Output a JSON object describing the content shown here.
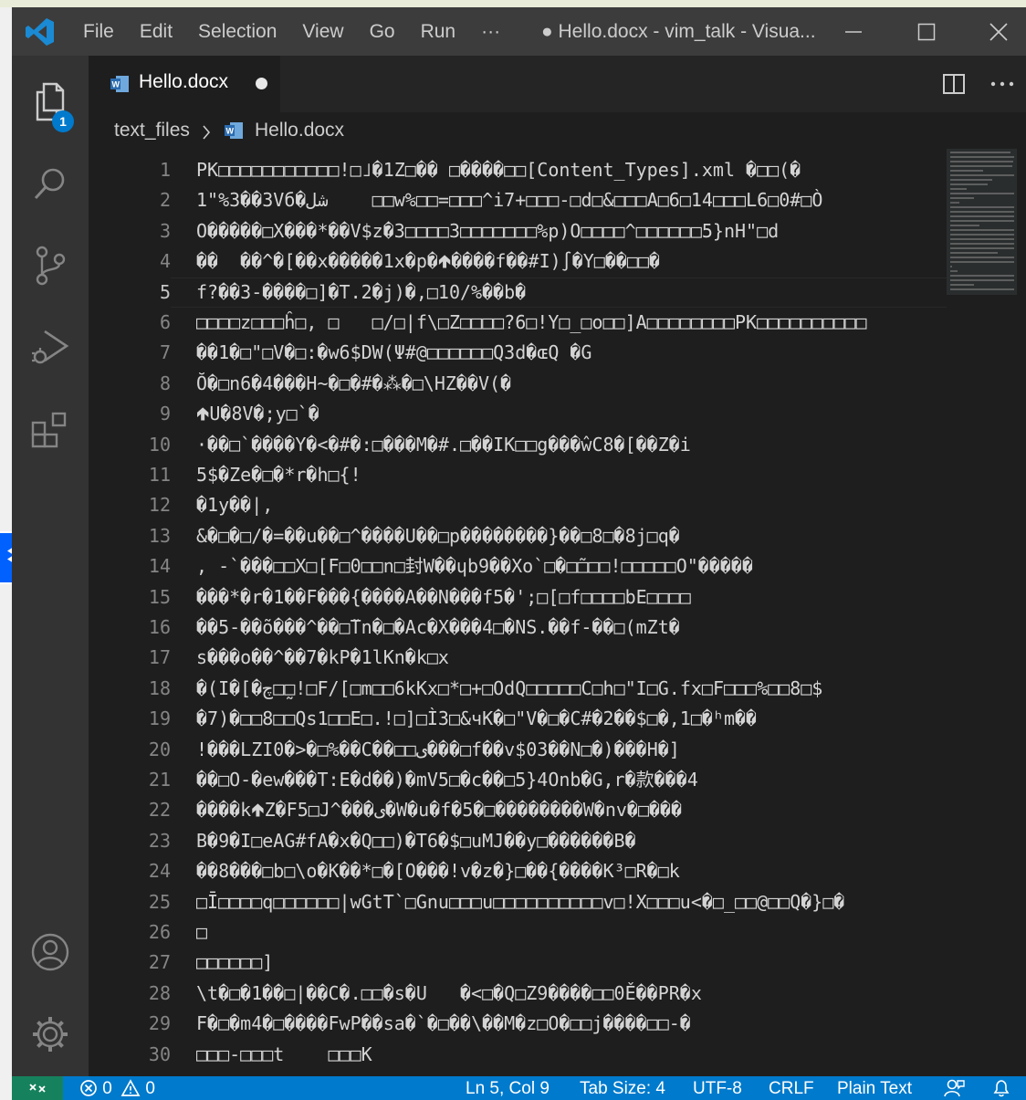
{
  "titlebar": {
    "menu": [
      "File",
      "Edit",
      "Selection",
      "View",
      "Go",
      "Run",
      "···"
    ],
    "window_title": "● Hello.docx - vim_talk - Visua..."
  },
  "activity": {
    "explorer_badge": "1"
  },
  "tabs": [
    {
      "label": "Hello.docx"
    }
  ],
  "breadcrumb": {
    "folder": "text_files",
    "file": "Hello.docx"
  },
  "editor": {
    "active_line": 5,
    "lines": [
      {
        "n": "1",
        "text": "PK□□□□□□□□□□□!□˩�1Z□�� □����□□[Content_Types].xml �□□(�"
      },
      {
        "n": "2",
        "text": "1\"%3��3Vб�شل    □□w%□□=□□□^i7+□□□-□d□&□□□A□6□14□□□L6□0#□Ò"
      },
      {
        "n": "3",
        "text": "O�����□X���*��V$z�3□□□□3□□□□□□□%p)O□□□□^□□□□□□5}nH\"□d"
      },
      {
        "n": "4",
        "text": "��  ��^�[��x�����1x�p�🢁����f��#I)∫�Y□��□□�"
      },
      {
        "n": "5",
        "text": "f?��3-����□]�T.2�j)�,□10/%��b�"
      },
      {
        "n": "6",
        "text": "□□□□z□□□ĥ□, □   □/□|f\\□Z□□□□?6□!Y□_□o□□]A□□□□□□□□PK□□□□□□□□□□"
      },
      {
        "n": "7",
        "text": "��1�□\"□V�□:�w6$DW(Ψ#@□□□□□□Q3d�ɶQ �G"
      },
      {
        "n": "8",
        "text": "Ŏ�□n6�4���H~�□�#�⁂�□\\HZ��V(�"
      },
      {
        "n": "9",
        "text": "🢁U�8V�;y□`�"
      },
      {
        "n": "10",
        "text": "·��□`����Y�<�#�:□���M�#.□��IK□□g���ŵС8�[��Z�i"
      },
      {
        "n": "11",
        "text": "5$�Ze�□�*r�h□{!"
      },
      {
        "n": "12",
        "text": "�1y��|,"
      },
      {
        "n": "13",
        "text": "&�□�□/�=��u��□^����U��□p��������}��□8□�8j□q�"
      },
      {
        "n": "14",
        "text": ", -`���□□X□[F□0□□n□封W��ɥb9��Xo`□�□̃□□□!□□□□□O\"�����"
      },
      {
        "n": "15",
        "text": "���*�r�1��F���{����A��N���f5�';□[□f□□□□bE□□□□"
      },
      {
        "n": "16",
        "text": "��5-��õ���^��□̃Tn�□�Ac�X���4□�NS.��f-��□(mZt�"
      },
      {
        "n": "17",
        "text": "s���o��^��7�kP�1lKn�k□x"
      },
      {
        "n": "18",
        "text": "�(I�[�چ□□̰!□F/[□m□□6kKx□*□+□OdQ□□□□□C□h□\"I□G.fx□F□□□%□□8□$"
      },
      {
        "n": "19",
        "text": "�7)�□□8□□Qs1□□E□.!□]□Ì3□&чK�□\"V�□�C#�2��$□�,1□�ʰm��"
      },
      {
        "n": "20",
        "text": "!���LZI0�>�□%��C��□□ی���□f��v$03��N□�)���H�]"
      },
      {
        "n": "21",
        "text": "��□O-�еw���T:E�d��)�mV5□�c��□5}4Onb�G,r�款���4"
      },
      {
        "n": "22",
        "text": "����k🢁Z�F5□J^���ی�W�u�f�5�□��������W�nv�□���"
      },
      {
        "n": "23",
        "text": "B�9�I□eAG#fA�x�Q□□)�T6�$□uMJ��y□������B�"
      },
      {
        "n": "24",
        "text": "��8���□b□\\o�K��*□�[O���!v�z�}□��{����K³□R�□k"
      },
      {
        "n": "25",
        "text": "□Ī□□□□q□□□□□□|wGtT`□Gnu□□□u□□□□□□□□□□v□!X□□□u<�□_□□@□□Q�}□�"
      },
      {
        "n": "26",
        "text": "□"
      },
      {
        "n": "27",
        "text": "□□□□□□]"
      },
      {
        "n": "28",
        "text": "\\t�□�1��□|��C�.□□�s�U   �<□�Q□Z9����□□0Ě��PR�x"
      },
      {
        "n": "29",
        "text": "F�□�m4�□����FwP��sa�`�□��\\��M�z□O�□□j����□□-�"
      },
      {
        "n": "30",
        "text": "□□□-□□□t    □□□K"
      }
    ]
  },
  "statusbar": {
    "errors": "0",
    "warnings": "0",
    "position": "Ln 5, Col 9",
    "tab_size": "Tab Size: 4",
    "encoding": "UTF-8",
    "eol": "CRLF",
    "language": "Plain Text"
  }
}
